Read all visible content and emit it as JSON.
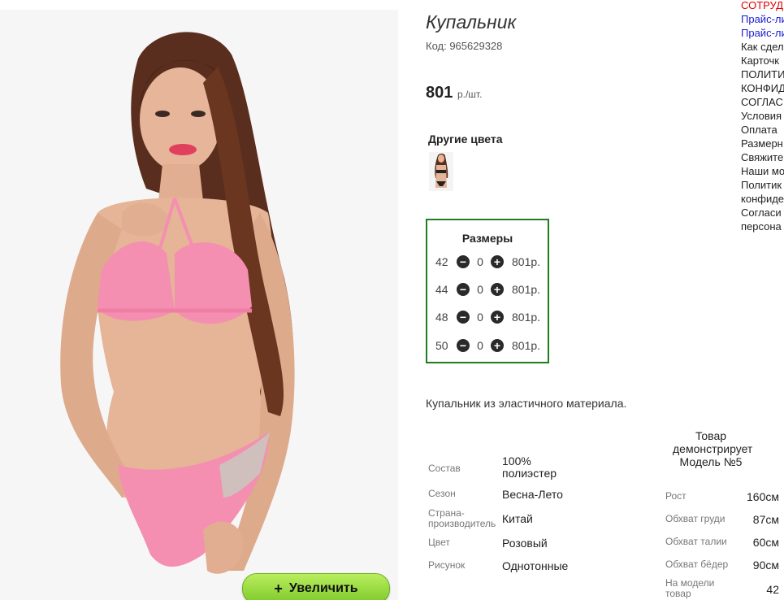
{
  "product": {
    "title": "Купальник",
    "code": "Код: 965629328",
    "price": "801",
    "price_unit": "р./шт.",
    "other_colors": "Другие цвета",
    "zoom_button": "Увеличить",
    "zoom_icon": "+",
    "description": "Купальник из эластичного материала."
  },
  "sizes": {
    "title": "Размеры",
    "minus_icon": "−",
    "plus_icon": "+",
    "rows": [
      {
        "size": "42",
        "qty": "0",
        "price": "801р."
      },
      {
        "size": "44",
        "qty": "0",
        "price": "801р."
      },
      {
        "size": "48",
        "qty": "0",
        "price": "801р."
      },
      {
        "size": "50",
        "qty": "0",
        "price": "801р."
      }
    ]
  },
  "specs": [
    {
      "label": "Состав",
      "value": "100% полиэстер"
    },
    {
      "label": "Сезон",
      "value": "Весна-Лето"
    },
    {
      "label": "Страна-производитель",
      "value": "Китай"
    },
    {
      "label": "Цвет",
      "value": "Розовый"
    },
    {
      "label": "Рисунок",
      "value": "Однотонные"
    }
  ],
  "model": {
    "heading": "Товар демонстрирует Модель №5",
    "rows": [
      {
        "label": "Рост",
        "value": "160см"
      },
      {
        "label": "Обхват груди",
        "value": "87см"
      },
      {
        "label": "Обхват талии",
        "value": "60см"
      },
      {
        "label": "Обхват бёдер",
        "value": "90см"
      },
      {
        "label": "На модели товар",
        "value": "42"
      }
    ]
  },
  "menu": [
    "СОТРУДН",
    "Прайс-ли",
    "Прайс-ли",
    "Как сдел",
    "Карточк",
    "ПОЛИТИ",
    "КОНФИД",
    "СОГЛАС",
    "Условия",
    "Оплата",
    "Размерн",
    "Свяжите",
    "Наши мо",
    "Политик",
    "конфиде",
    "Согласи",
    "персона"
  ]
}
